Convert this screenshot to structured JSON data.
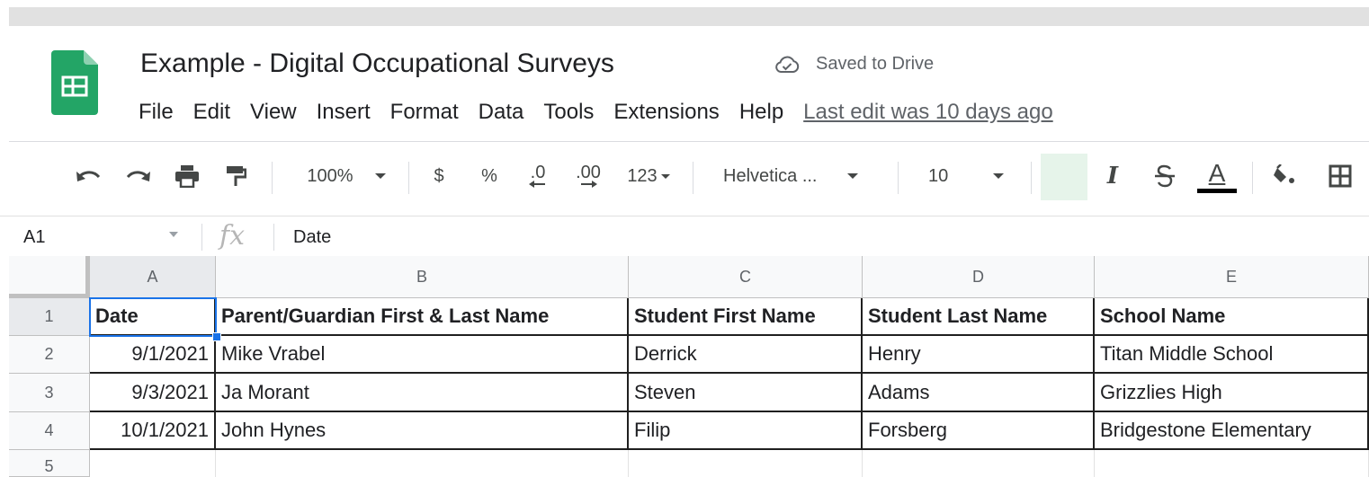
{
  "app": {
    "title": "Example - Digital Occupational Surveys",
    "save_status": "Saved to Drive",
    "last_edit": "Last edit was 10 days ago",
    "menu": [
      "File",
      "Edit",
      "View",
      "Insert",
      "Format",
      "Data",
      "Tools",
      "Extensions",
      "Help"
    ]
  },
  "toolbar": {
    "zoom": "100%",
    "currency": "$",
    "percent": "%",
    "decrease_decimal": ".0",
    "increase_decimal": ".00",
    "more_formats": "123",
    "font": "Helvetica ...",
    "font_size": "10",
    "bold_label": "I",
    "text_color_label": "A"
  },
  "formula_bar": {
    "cell_ref": "A1",
    "fx": "fx",
    "value": "Date"
  },
  "sheet": {
    "columns": [
      "A",
      "B",
      "C",
      "D",
      "E"
    ],
    "row_numbers": [
      "1",
      "2",
      "3",
      "4",
      "5"
    ],
    "rows": [
      [
        "Date",
        "Parent/Guardian First & Last Name",
        "Student First Name",
        "Student Last Name",
        "School Name"
      ],
      [
        "9/1/2021",
        "Mike Vrabel",
        "Derrick",
        "Henry",
        "Titan Middle School"
      ],
      [
        "9/3/2021",
        "Ja Morant",
        "Steven",
        "Adams",
        "Grizzlies High"
      ],
      [
        "10/1/2021",
        "John Hynes",
        "Filip",
        "Forsberg",
        "Bridgestone Elementary"
      ]
    ]
  },
  "colors": {
    "logo_green": "#23a566",
    "selection_blue": "#1a73e8",
    "fill_swatch": "#e6f4ea"
  }
}
